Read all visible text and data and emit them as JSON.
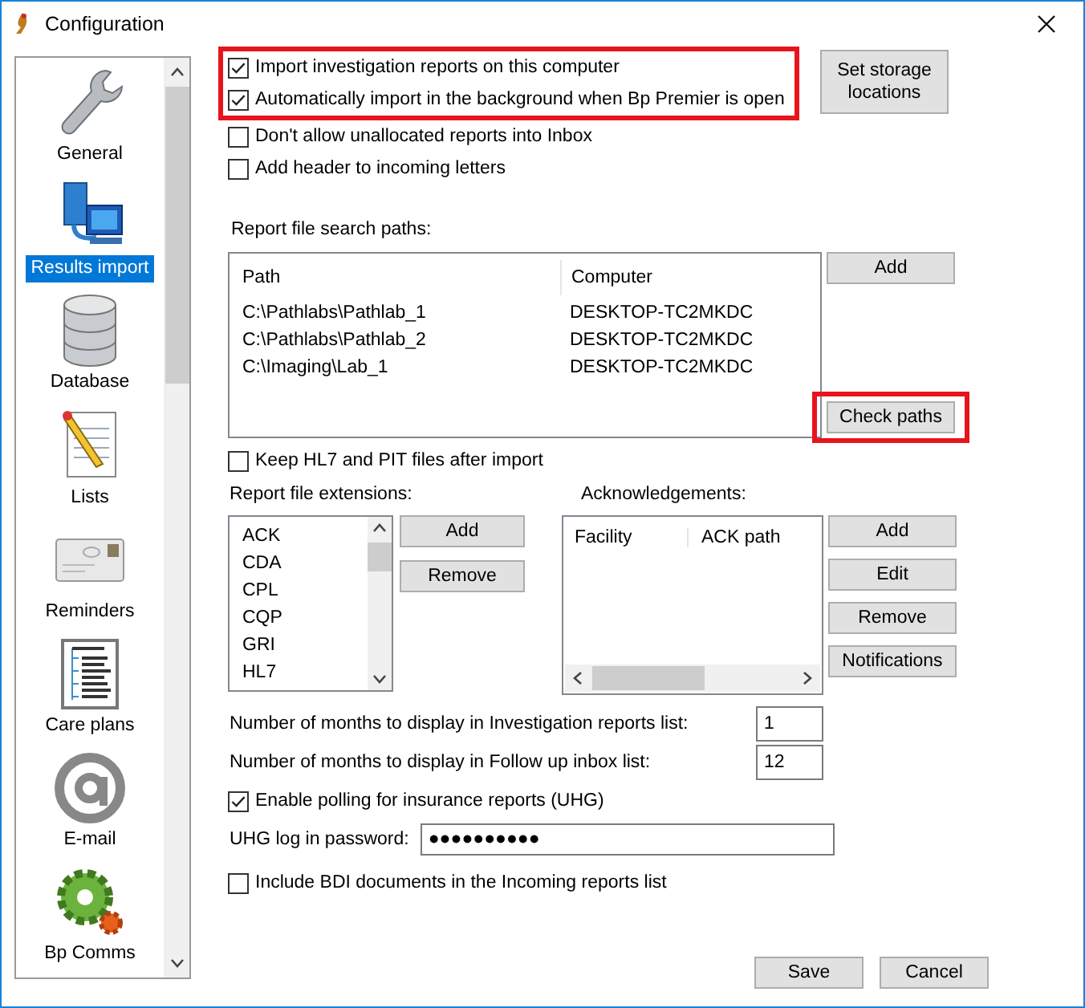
{
  "window": {
    "title": "Configuration"
  },
  "sidebar": {
    "items": [
      {
        "label": "General",
        "selected": false
      },
      {
        "label": "Results import",
        "selected": true
      },
      {
        "label": "Database",
        "selected": false
      },
      {
        "label": "Lists",
        "selected": false
      },
      {
        "label": "Reminders",
        "selected": false
      },
      {
        "label": "Care plans",
        "selected": false
      },
      {
        "label": "E-mail",
        "selected": false
      },
      {
        "label": "Bp Comms",
        "selected": false
      }
    ]
  },
  "top_options": {
    "highlighted": true,
    "items": [
      {
        "label": "Import investigation reports on this computer",
        "checked": true
      },
      {
        "label": "Automatically import in the background when Bp Premier is open",
        "checked": true
      }
    ]
  },
  "more_options": [
    {
      "label": "Don't allow unallocated reports into Inbox",
      "checked": false
    },
    {
      "label": "Add header to incoming letters",
      "checked": false
    }
  ],
  "set_storage_button": "Set storage locations",
  "search_paths": {
    "label": "Report file search paths:",
    "columns": [
      "Path",
      "Computer"
    ],
    "rows": [
      [
        "C:\\Pathlabs\\Pathlab_1",
        "DESKTOP-TC2MKDC"
      ],
      [
        "C:\\Pathlabs\\Pathlab_2",
        "DESKTOP-TC2MKDC"
      ],
      [
        "C:\\Imaging\\Lab_1",
        "DESKTOP-TC2MKDC"
      ]
    ],
    "add_button": "Add",
    "check_button": {
      "label": "Check paths",
      "highlighted": true
    }
  },
  "keep_files": {
    "label": "Keep HL7 and PIT files after import",
    "checked": false
  },
  "extensions": {
    "label": "Report file extensions:",
    "items": [
      "ACK",
      "CDA",
      "CPL",
      "CQP",
      "GRI",
      "HL7"
    ],
    "buttons": [
      "Add",
      "Remove"
    ]
  },
  "acknowledgements": {
    "label": "Acknowledgements:",
    "columns": [
      "Facility",
      "ACK path"
    ],
    "buttons": [
      "Add",
      "Edit",
      "Remove",
      "Notifications"
    ]
  },
  "months": [
    {
      "label": "Number of months to display in Investigation reports list:",
      "value": "1"
    },
    {
      "label": "Number of months to display in Follow up inbox list:",
      "value": "12"
    }
  ],
  "polling": {
    "label": "Enable polling for insurance reports (UHG)",
    "checked": true
  },
  "password": {
    "label": "UHG log in password:",
    "value": "●●●●●●●●●●"
  },
  "include_bdi": {
    "label": "Include BDI documents in the Incoming reports list",
    "checked": false
  },
  "footer_buttons": [
    "Save",
    "Cancel"
  ]
}
